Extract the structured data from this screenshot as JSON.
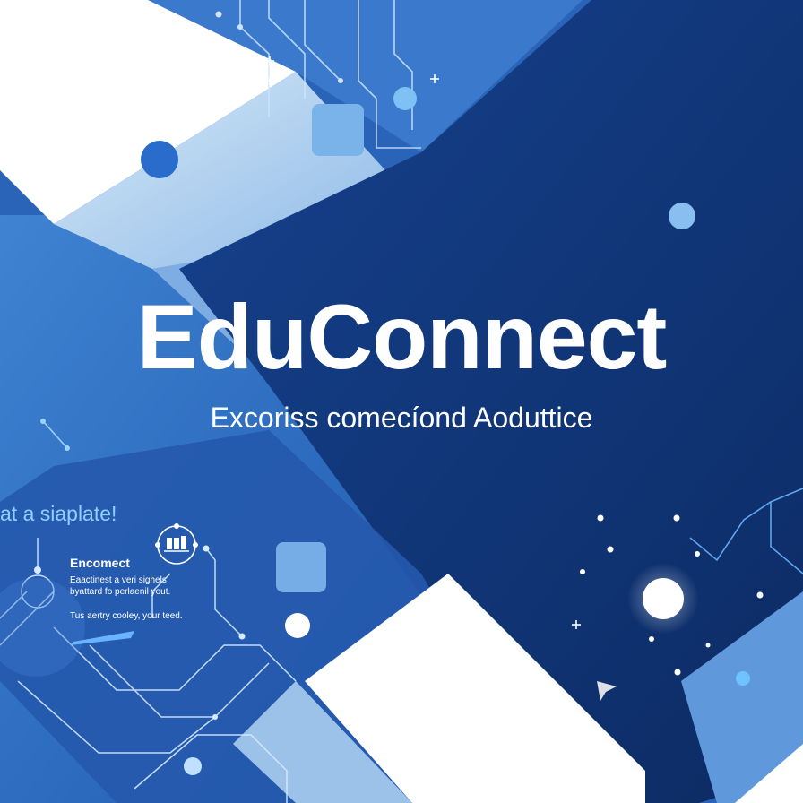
{
  "hero": {
    "title": "EduConnect",
    "subtitle": "Excoriss comecíond Aoduttice"
  },
  "side_phrase": "at a siaplate!",
  "card": {
    "heading": "Encomect",
    "body_lines": [
      "Eaactinest a veri sighels",
      "byattard fo perlaenil yout."
    ],
    "footer": "Tus aertry cooley, your teed."
  },
  "colors": {
    "deep_navy": "#0f3577",
    "mid_blue": "#2c6bc0",
    "light_blue": "#6ea5df",
    "pale_blue": "#bcd8f3",
    "white": "#ffffff",
    "accent_cyan": "#8fd0ff"
  },
  "icons": [
    "book-icon"
  ]
}
